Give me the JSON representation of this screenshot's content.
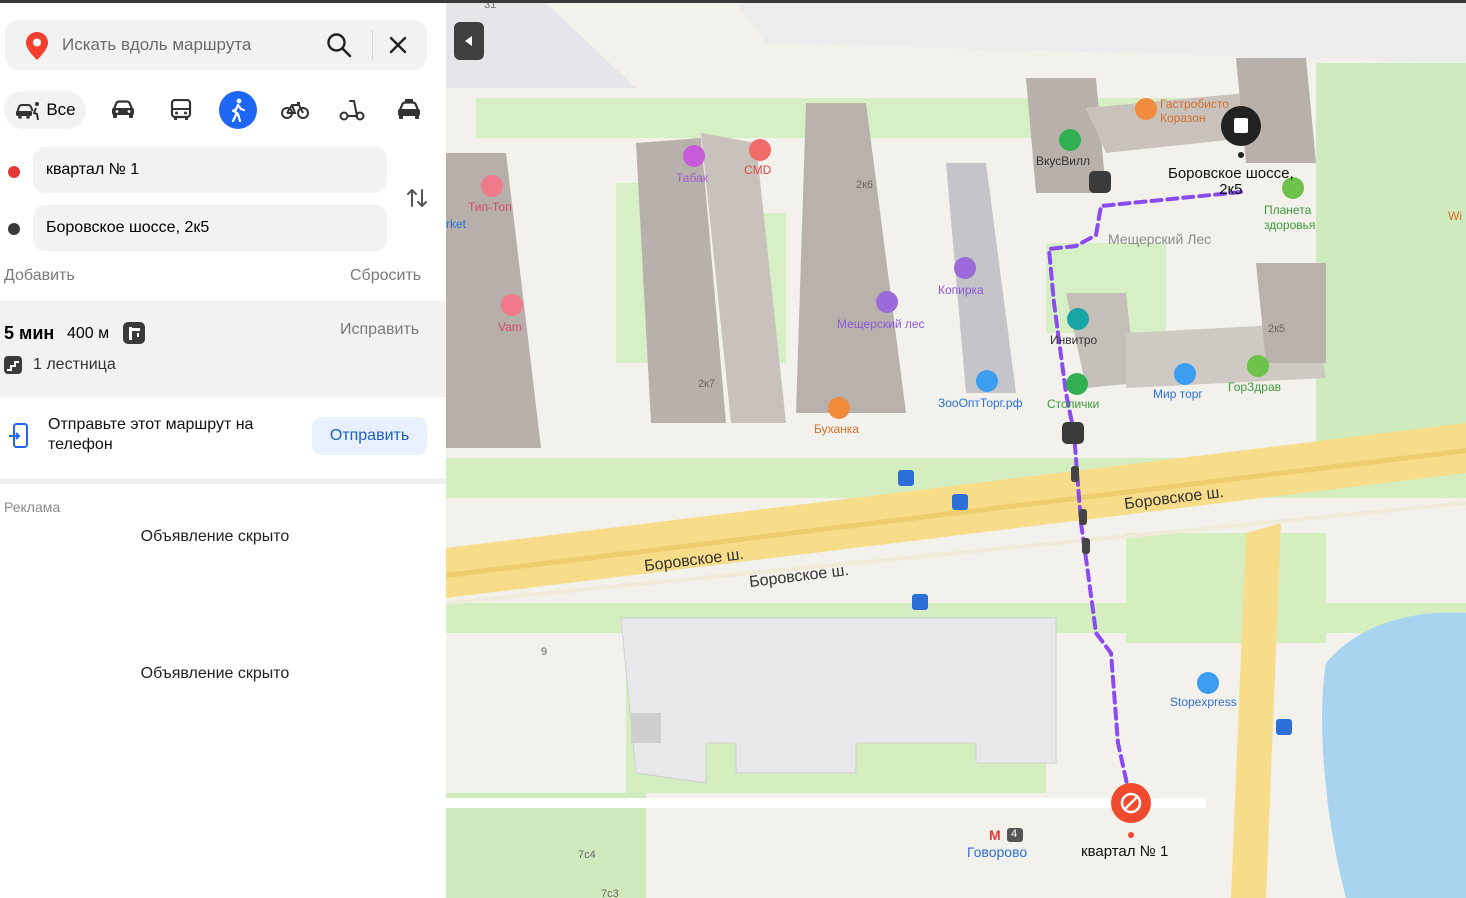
{
  "search": {
    "placeholder": "Искать вдоль маршрута"
  },
  "modes": {
    "all_label": "Все",
    "icons": [
      "car-walk-icon",
      "car-icon",
      "bus-icon",
      "walk-icon",
      "bike-icon",
      "scooter-icon",
      "taxi-icon"
    ],
    "active": "walk-icon"
  },
  "waypoints": [
    {
      "text": "квартал № 1",
      "color": "#e53935"
    },
    {
      "text": "Боровское шоссе, 2к5",
      "color": "#3a3a3a"
    }
  ],
  "actions": {
    "add": "Добавить",
    "reset": "Сбросить"
  },
  "route": {
    "time": "5 мин",
    "distance": "400 м",
    "fix": "Исправить",
    "stairs": "1 лестница"
  },
  "send": {
    "text": "Отправьте этот маршрут на телефон",
    "button": "Отправить"
  },
  "ads": {
    "label": "Реклама",
    "hidden_1": "Объявление скрыто",
    "hidden_2": "Объявление скрыто"
  },
  "colors": {
    "accent": "#1e66f5",
    "route": "#8a4cf0",
    "start": "#e53935"
  },
  "map": {
    "roads": {
      "a": "Боровское ш.",
      "b": "Боровское ш.",
      "c": "Боровское ш."
    },
    "places": {
      "gastro": "Гастробисто\nКоразон",
      "vkusvill": "ВкусВилл",
      "dest": "Боровское шоссе,\n2к5",
      "planeta": "Планета\nздоровья",
      "wi": "Wi",
      "forest": "Мещерский Лес",
      "tabak": "Табак",
      "cmd": "CMD",
      "tiptop": "Тип-Топ",
      "market": "rket",
      "kopirka": "Копирка",
      "meshch": "Мещерский лес",
      "invitro": "Инвитро",
      "vam": "Vam",
      "stolichki": "Столички",
      "mirtorg": "Мир торг",
      "gorzdrav": "ГорЗдрав",
      "zoo": "ЗооОптТорг.рф",
      "buhanka": "Буханка",
      "stopexpress": "Stopexpress",
      "govorovo": "Говорово",
      "metro_line": "4",
      "kvartal": "квартал № 1"
    },
    "buildings": {
      "b31": "31",
      "b2k6": "2к6",
      "b2k7": "2к7",
      "b2k5": "2к5",
      "b9": "9",
      "b7c4": "7с4",
      "b7c3": "7с3"
    }
  }
}
